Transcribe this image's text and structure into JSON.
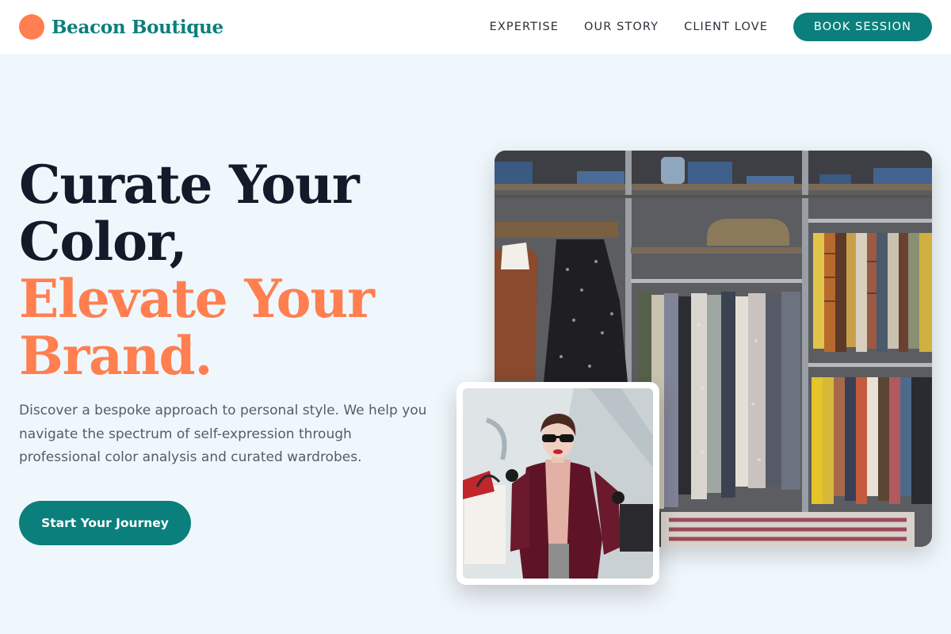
{
  "header": {
    "brand_name": "Beacon Boutique",
    "nav": [
      "EXPERTISE",
      "OUR STORY",
      "CLIENT LOVE"
    ],
    "cta_label": "BOOK SESSION"
  },
  "hero": {
    "title_lines": [
      "Curate Your",
      "Color,",
      "Elevate Your",
      "Brand."
    ],
    "subtitle": "Discover a bespoke approach to personal style. We help you navigate the spectrum of self-expression through professional color analysis and curated wardrobes.",
    "button_label": "Start Your Journey"
  },
  "images": {
    "main_photo": "clothing-rack-photo",
    "secondary_photo": "shopping-woman-photo"
  },
  "colors": {
    "brand_teal": "#0b7f7c",
    "accent_coral": "#ff7f50",
    "heading_dark": "#141a2a",
    "page_background": "#f0f7fc"
  }
}
